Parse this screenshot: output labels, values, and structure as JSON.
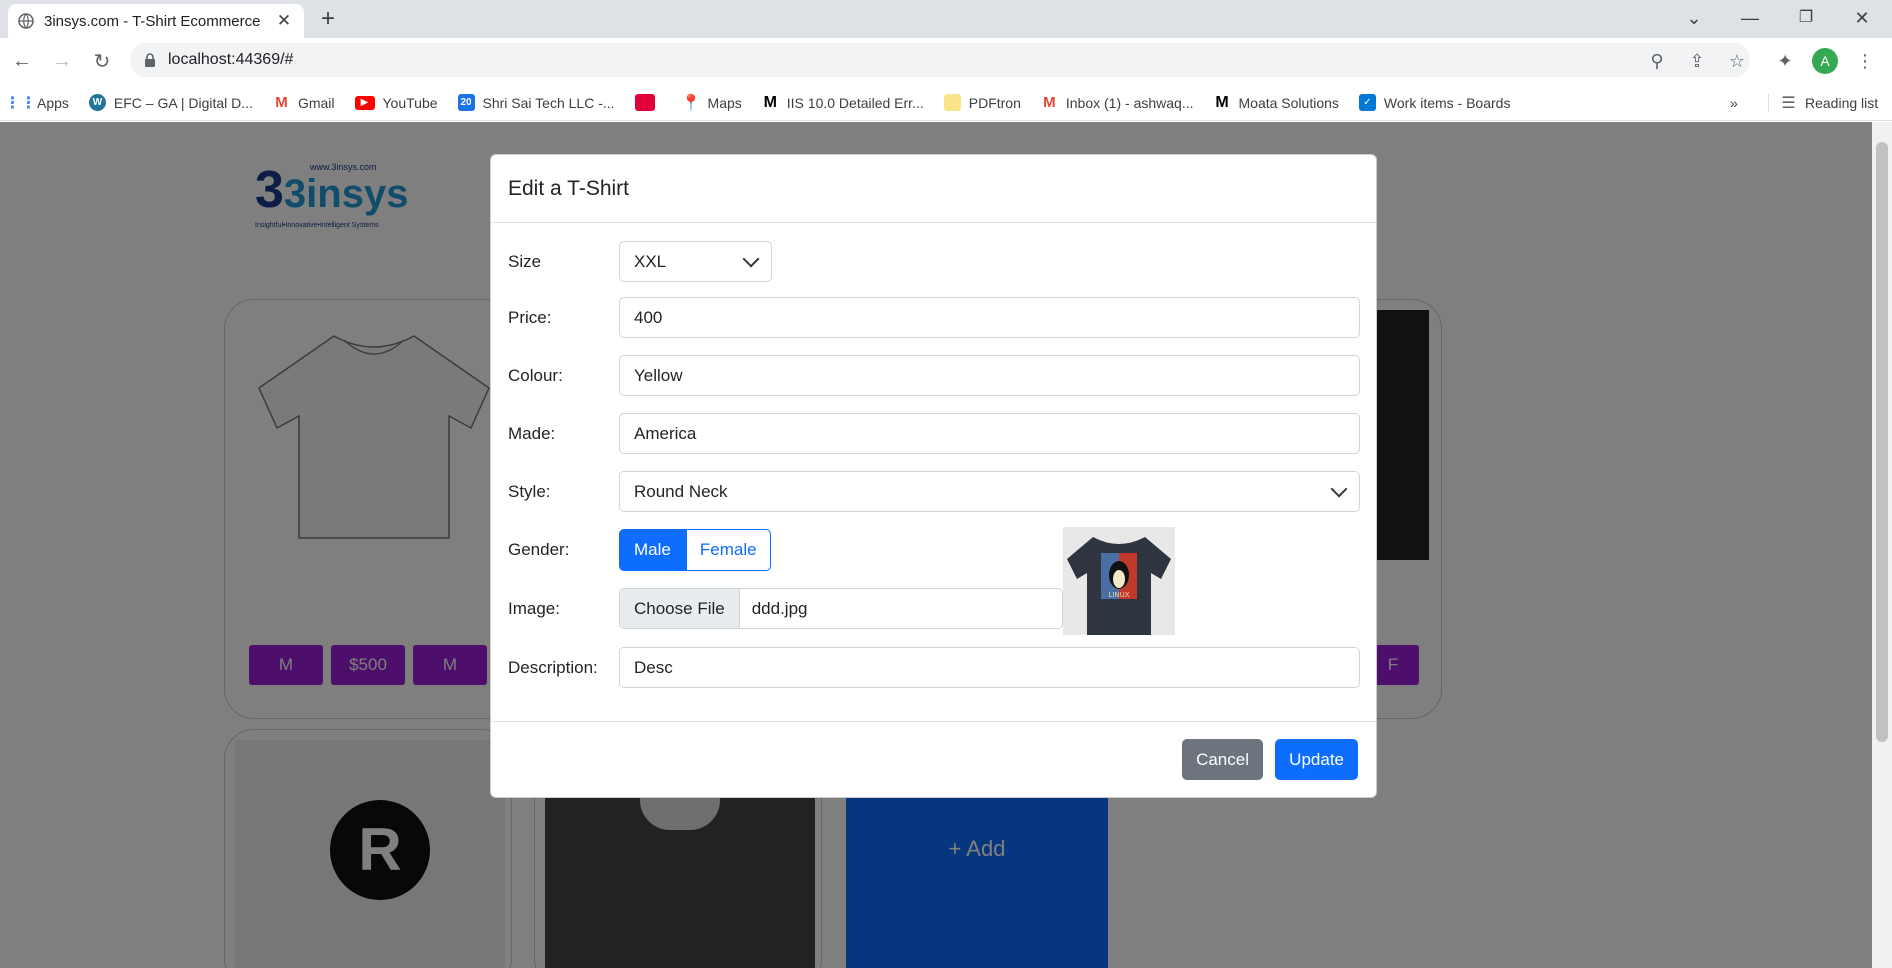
{
  "browser": {
    "tab_title": "3insys.com - T-Shirt Ecommerce",
    "url": "localhost:44369/#",
    "avatar_letter": "A",
    "bookmarks": [
      {
        "label": "Apps",
        "color": "#ea4335"
      },
      {
        "label": "EFC – GA | Digital D...",
        "color": "#21759b"
      },
      {
        "label": "Gmail",
        "color": "#ea4335"
      },
      {
        "label": "YouTube",
        "color": "#ff0000"
      },
      {
        "label": "Shri Sai Tech LLC -...",
        "color": "#1a73e8"
      },
      {
        "label": "",
        "color": "#e2003b"
      },
      {
        "label": "Maps",
        "color": "#34a853"
      },
      {
        "label": "IIS 10.0 Detailed Err...",
        "color": "#000000"
      },
      {
        "label": "PDFtron",
        "color": "#fbbc04"
      },
      {
        "label": "Inbox (1) - ashwaq...",
        "color": "#ea4335"
      },
      {
        "label": "Moata Solutions",
        "color": "#000000"
      },
      {
        "label": "Work items - Boards",
        "color": "#0078d4"
      }
    ],
    "overflow": "»",
    "reading_list": "Reading list"
  },
  "page": {
    "logo_text": "3insys",
    "logo_url": "www.3insys.com",
    "logo_tagline": "Insightful•Innovative•Intelligent Systems",
    "card_pills": [
      "M",
      "$500",
      "M"
    ],
    "right_pill_fragment": "F",
    "add_label": "+ Add"
  },
  "modal": {
    "title": "Edit a T-Shirt",
    "size_label": "Size",
    "size_value": "XXL",
    "price_label": "Price:",
    "price_value": "400",
    "colour_label": "Colour:",
    "colour_value": "Yellow",
    "made_label": "Made:",
    "made_value": "America",
    "style_label": "Style:",
    "style_value": "Round Neck",
    "gender_label": "Gender:",
    "gender_male": "Male",
    "gender_female": "Female",
    "gender_selected": "Male",
    "image_label": "Image:",
    "choose_file": "Choose File",
    "file_name": "ddd.jpg",
    "preview_text": "LINUX",
    "description_label": "Description:",
    "description_value": "Desc",
    "cancel": "Cancel",
    "update": "Update"
  },
  "colors": {
    "primary": "#0d6efd",
    "secondary": "#6c757d",
    "pill": "#9a1fd6",
    "add_tile": "#0d6efd"
  }
}
